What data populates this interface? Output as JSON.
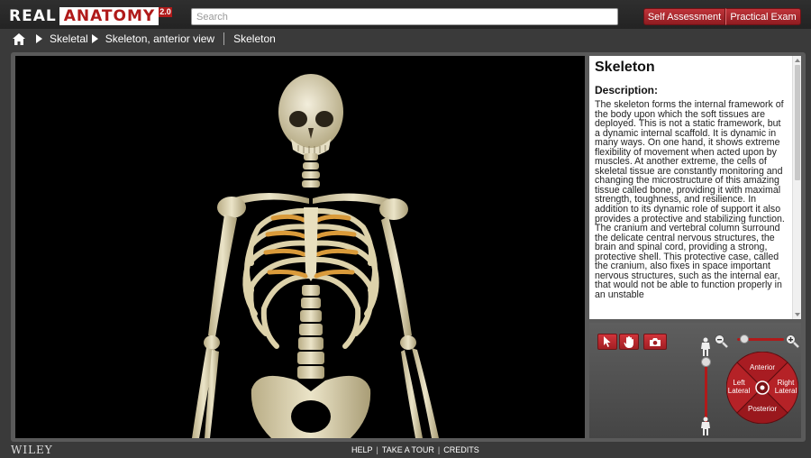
{
  "header": {
    "logo_real": "REAL",
    "logo_anatomy": "ANATOMY",
    "logo_version": "2.0",
    "search_placeholder": "Search",
    "buttons": [
      "Self Assessment",
      "Practical Exam"
    ]
  },
  "breadcrumb": {
    "items": [
      "Skeletal",
      "Skeleton, anterior view"
    ],
    "current": "Skeleton"
  },
  "description": {
    "title": "Skeleton",
    "label": "Description:",
    "text": "The skeleton forms the internal framework of the body upon which the soft tissues are deployed. This is not a static framework, but a dynamic internal scaffold. It is dynamic in many ways. On one hand, it shows extreme flexibility of movement when acted upon by muscles. At another extreme, the cells of skeletal tissue are constantly monitoring and changing the microstructure of this amazing tissue called bone, providing it with maximal strength, toughness, and resilience. In addition to its dynamic role of support it also provides a protective and stabilizing function. The cranium and vertebral column surround the delicate central nervous structures, the brain and spinal cord, providing a strong, protective shell. This protective case, called the cranium, also fixes in space important nervous structures, such as the internal ear, that would not be able to function properly in an unstable"
  },
  "controls": {
    "tools": [
      "pointer-icon",
      "hand-icon",
      "camera-icon"
    ],
    "dial": {
      "top": "Anterior",
      "left": "Left Lateral",
      "right": "Right Lateral",
      "bottom": "Posterior"
    }
  },
  "footer": {
    "brand": "WILEY",
    "links": [
      "HELP",
      "TAKE A TOUR",
      "CREDITS"
    ]
  },
  "colors": {
    "accent": "#b01a1a",
    "background": "#3a3a3a",
    "viewer": "#000000"
  }
}
